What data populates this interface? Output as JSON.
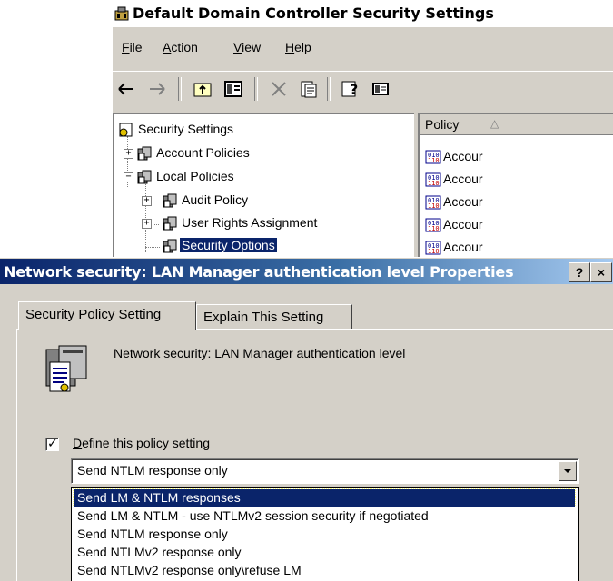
{
  "mmc": {
    "title": "Default Domain Controller Security Settings",
    "menu": [
      {
        "label": "File",
        "mnemonic": "F",
        "rest": "ile"
      },
      {
        "label": "Action",
        "mnemonic": "A",
        "rest": "ction"
      },
      {
        "label": "View",
        "mnemonic": "V",
        "rest": "iew"
      },
      {
        "label": "Help",
        "mnemonic": "H",
        "rest": "elp"
      }
    ],
    "toolbar_icons": [
      "back-arrow-icon",
      "forward-arrow-icon",
      "up-folder-icon",
      "show-hide-tree-icon",
      "delete-icon",
      "properties-icon",
      "help-icon",
      "console-pane-icon"
    ],
    "tree": [
      {
        "label": "Security Settings",
        "icon": "security-settings-icon"
      },
      {
        "label": "Account Policies",
        "icon": "policy-folder-icon",
        "expander": "+"
      },
      {
        "label": "Local Policies",
        "icon": "policy-folder-icon",
        "expander": "-"
      },
      {
        "label": "Audit Policy",
        "icon": "policy-folder-icon",
        "expander": "+"
      },
      {
        "label": "User Rights Assignment",
        "icon": "policy-folder-icon",
        "expander": "+"
      },
      {
        "label": "Security Options",
        "icon": "policy-folder-icon",
        "selected": true
      }
    ],
    "list": {
      "column_header": "Policy",
      "rows": [
        "Accour",
        "Accour",
        "Accour",
        "Accour",
        "Accour"
      ]
    }
  },
  "dialog": {
    "title": "Network security: LAN Manager authentication level Properties",
    "help_button": "?",
    "close_button": "×",
    "tabs": [
      "Security Policy Setting",
      "Explain This Setting"
    ],
    "active_tab": 0,
    "policy_name": "Network security: LAN Manager authentication level",
    "define_checkbox": {
      "mnemonic": "D",
      "rest": "efine this policy setting",
      "checked": true
    },
    "combo": {
      "value": "Send NTLM response only",
      "options": [
        "Send LM & NTLM responses",
        "Send LM & NTLM - use NTLMv2 session security if negotiated",
        "Send NTLM response only",
        "Send NTLMv2 response only",
        "Send NTLMv2 response only\\refuse LM"
      ],
      "highlighted_index": 0
    }
  },
  "colors": {
    "window_face": "#d4d0c8",
    "selection": "#0a246a",
    "title_gradient_start": "#0a246a",
    "title_gradient_end": "#a6caf0"
  }
}
